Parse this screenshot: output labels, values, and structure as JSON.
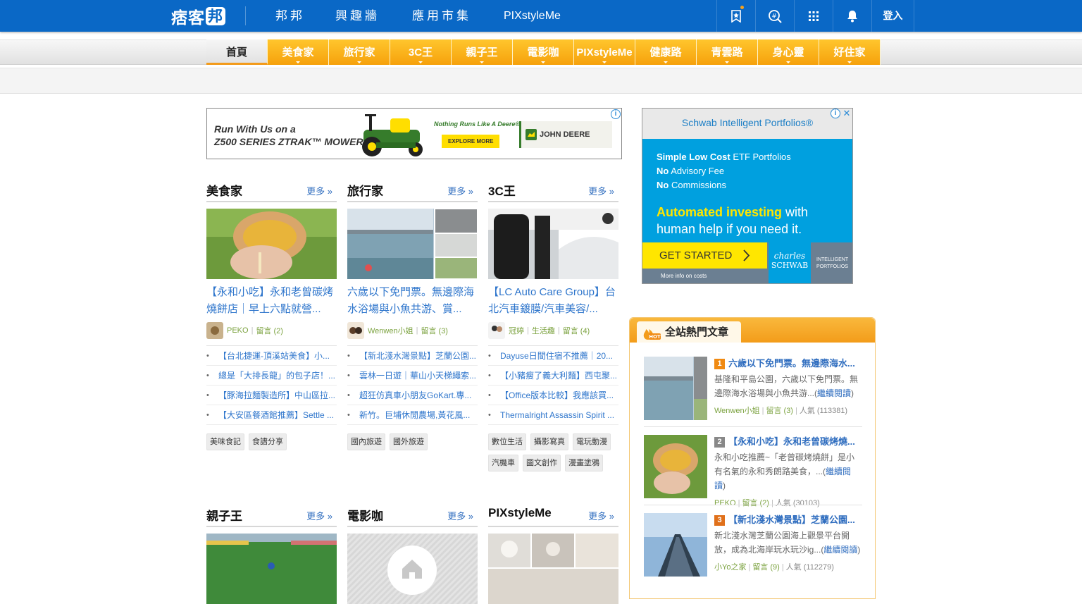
{
  "topbar": {
    "logo_text": "痞客",
    "logo_badge": "邦",
    "nav": [
      "邦邦",
      "興趣牆",
      "應用市集",
      "PIXstyleMe"
    ],
    "login": "登入"
  },
  "categories": [
    {
      "label": "首頁",
      "active": true
    },
    {
      "label": "美食家"
    },
    {
      "label": "旅行家"
    },
    {
      "label": "3C王"
    },
    {
      "label": "親子王"
    },
    {
      "label": "電影咖"
    },
    {
      "label": "PIXstyleMe"
    },
    {
      "label": "健康路"
    },
    {
      "label": "青雲路"
    },
    {
      "label": "身心靈"
    },
    {
      "label": "好住家"
    }
  ],
  "ad_banner": {
    "headline_1": "Run With Us on a",
    "headline_2": "Z500 SERIES ZTRAK™ MOWER",
    "slogan": "Nothing Runs Like A Deere®",
    "button": "EXPLORE MORE",
    "brand": "JOHN DEERE"
  },
  "ad_side": {
    "header": "Schwab Intelligent Portfolios®",
    "line1_b": "Simple Low Cost",
    "line1": " ETF Portfolios",
    "line2_b": "No",
    "line2": " Advisory Fee",
    "line3_b": "No",
    "line3": " Commissions",
    "big_b": "Automated investing",
    "big": " with human help if you need it.",
    "cta": "GET STARTED",
    "costs": "More info on costs",
    "brand_1": "charles",
    "brand_2": "SCHWAB",
    "ip_1": "INTELLIGENT",
    "ip_2": "PORTFOLIOS"
  },
  "more_label": "更多 »",
  "sections": [
    {
      "title": "美食家",
      "feature_title": "【永和小吃】永和老曾碳烤燒餅店｜早上六點就營...",
      "author": "PEKO",
      "comments": "留言 (2)",
      "posts": [
        "【台北捷運-頂溪站美食】小...",
        "總是「大排長龍」的包子店！...",
        "【豚海拉麵製造所】中山區拉...",
        "【大安區餐酒館推薦】Settle ..."
      ],
      "tags": [
        "美味食記",
        "食譜分享"
      ]
    },
    {
      "title": "旅行家",
      "feature_title": "六歲以下免門票。無邊際海水浴場與小魚共游、賞...",
      "author": "Wenwen小姐",
      "comments": "留言 (3)",
      "posts": [
        "【新北淺水灣景點】芝蘭公園...",
        "雲林一日遊｜華山小天梯繩索...",
        "超狂仿真車小朋友GoKart.專...",
        "新竹。巨埔休閒農場,黃花風..."
      ],
      "tags": [
        "國內旅遊",
        "國外旅遊"
      ]
    },
    {
      "title": "3C王",
      "feature_title": "【LC Auto Care Group】台北汽車鍍膜/汽車美容/...",
      "author": "冠婷",
      "category": "生活趣",
      "comments": "留言 (4)",
      "posts": [
        "Dayuse日間住宿不推薦｜20...",
        "【小豬瘦了義大利麵】西屯聚...",
        "【Office版本比較】我應該買...",
        "Thermalright Assassin Spirit ..."
      ],
      "tags": [
        "數位生活",
        "攝影寫真",
        "電玩動漫",
        "汽機車",
        "圖文創作",
        "漫畫塗鴉"
      ]
    }
  ],
  "sections_row2": [
    "親子王",
    "電影咖",
    "PIXstyleMe"
  ],
  "hot": {
    "title": "全站熱門文章",
    "badge": "HOT",
    "read_more": "繼續閱讀",
    "items": [
      {
        "rank": "1",
        "title": "六歲以下免門票。無邊際海水...",
        "desc": "基隆和平島公園，六歲以下免門票。無邊際海水浴場與小魚共游...",
        "author": "Wenwen小姐",
        "comments": "留言 (3)",
        "popularity": "人氣 (113381)",
        "rank_color": "#f08a12"
      },
      {
        "rank": "2",
        "title": "【永和小吃】永和老曾碳烤燒...",
        "desc": "永和小吃推薦~「老曾碳烤燒餅」是小有名氣的永和秀朗路美食，...",
        "author": "PEKO",
        "comments": "留言 (2)",
        "popularity": "人氣 (30103)",
        "rank_color": "#888888"
      },
      {
        "rank": "3",
        "title": "【新北淺水灣景點】芝蘭公園...",
        "desc": "新北淺水灣芝蘭公園海上觀景平台開放，成為北海岸玩水玩沙ig...",
        "author": "小Yo之家",
        "comments": "留言 (9)",
        "popularity": "人氣 (112279)",
        "rank_color": "#e0701a"
      }
    ]
  }
}
